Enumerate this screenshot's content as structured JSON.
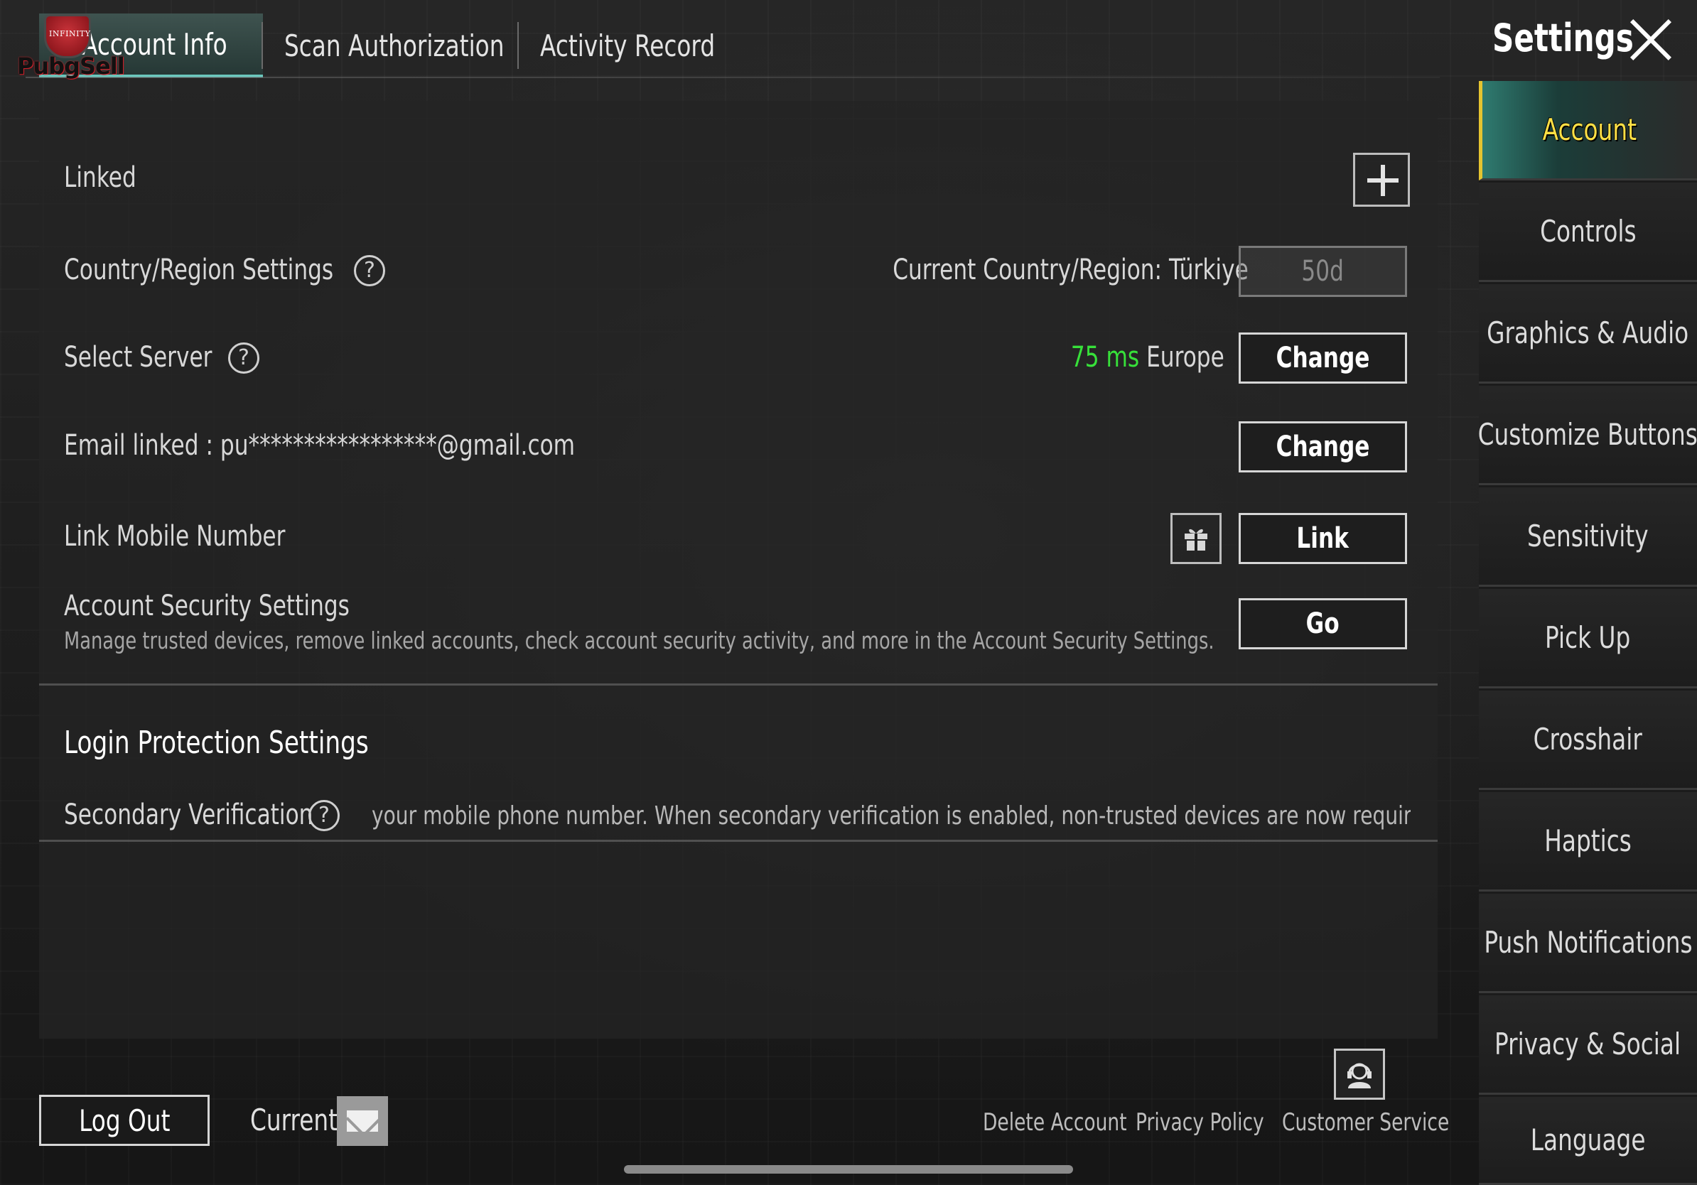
{
  "header": {
    "tabs": [
      {
        "label": "Account Info",
        "active": true
      },
      {
        "label": "Scan Authorization",
        "active": false
      },
      {
        "label": "Activity Record",
        "active": false
      }
    ],
    "watermark": "PubgSell",
    "settings_title": "Settings"
  },
  "account": {
    "linked_label": "Linked",
    "country_label": "Country/Region Settings",
    "country_current": "Current Country/Region: Türkiye",
    "country_cooldown": "50d",
    "server_label": "Select Server",
    "server_ping": "75 ms",
    "server_region": "Europe",
    "server_button": "Change",
    "email_label": "Email linked : pu*****************@gmail.com",
    "email_button": "Change",
    "mobile_label": "Link Mobile Number",
    "mobile_button": "Link",
    "security_label": "Account Security Settings",
    "security_desc": "Manage trusted devices, remove linked accounts, check account security activity, and more in the Account Security Settings.",
    "security_button": "Go"
  },
  "login_protection": {
    "title": "Login Protection Settings",
    "secondary_label": "Secondary Verification",
    "secondary_desc": "your mobile phone number. When secondary verification is enabled, non-trusted devices are now required to complete the s"
  },
  "footer": {
    "logout": "Log Out",
    "current": "Current",
    "delete_account": "Delete Account",
    "privacy_policy": "Privacy Policy",
    "customer_service": "Customer Service"
  },
  "nav": {
    "items": [
      {
        "label": "Account",
        "active": true
      },
      {
        "label": "Controls"
      },
      {
        "label": "Graphics & Audio"
      },
      {
        "label": "Customize Buttons"
      },
      {
        "label": "Sensitivity"
      },
      {
        "label": "Pick Up"
      },
      {
        "label": "Crosshair"
      },
      {
        "label": "Haptics"
      },
      {
        "label": "Push Notifications"
      },
      {
        "label": "Privacy & Social"
      },
      {
        "label": "Language"
      }
    ]
  },
  "colors": {
    "accent_teal": "#6bc7bd",
    "active_nav_text": "#ffe045",
    "ping_green": "#37e13a"
  }
}
